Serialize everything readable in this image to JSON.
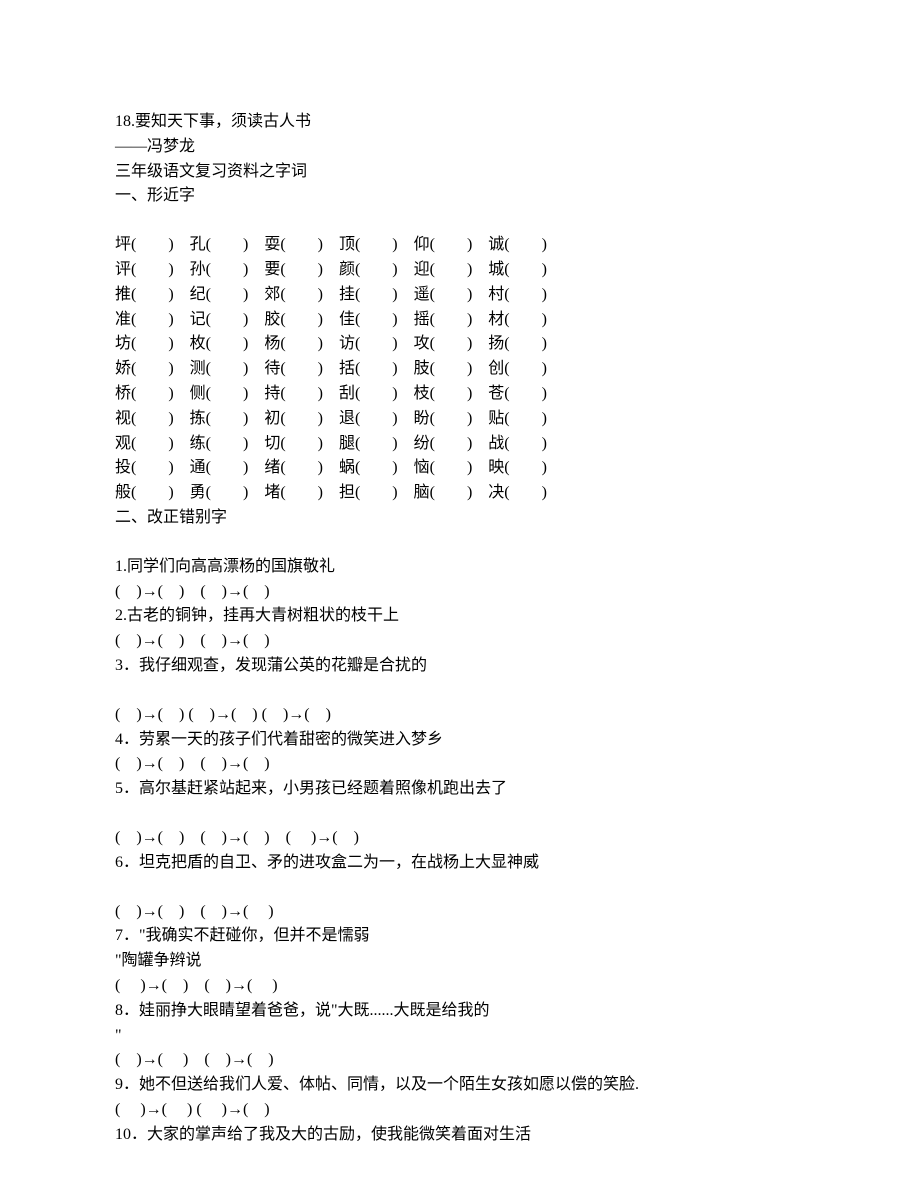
{
  "header": {
    "line1": "18.要知天下事，须读古人书",
    "line2": "——冯梦龙",
    "line3": "三年级语文复习资料之字词",
    "section1_title": "一、形近字"
  },
  "grid": [
    [
      "坪",
      "孔",
      "耍",
      "顶",
      "仰",
      "诚"
    ],
    [
      "评",
      "孙",
      "要",
      "颜",
      "迎",
      "城"
    ],
    [
      "推",
      "纪",
      "郊",
      "挂",
      "遥",
      "村"
    ],
    [
      "准",
      "记",
      "胶",
      "佳",
      "摇",
      "材"
    ],
    [
      "坊",
      "枚",
      "杨",
      "访",
      "攻",
      "扬"
    ],
    [
      "娇",
      "测",
      "待",
      "括",
      "肢",
      "创"
    ],
    [
      "桥",
      "侧",
      "持",
      "刮",
      "枝",
      "苍"
    ],
    [
      "视",
      "拣",
      "初",
      "退",
      "盼",
      "贴"
    ],
    [
      "观",
      "练",
      "切",
      "腿",
      "纷",
      "战"
    ],
    [
      "投",
      "通",
      "绪",
      "蜗",
      "恼",
      "映"
    ],
    [
      "般",
      "勇",
      "堵",
      "担",
      "脑",
      "决"
    ]
  ],
  "section2_title": "二、改正错别字",
  "q": {
    "q1": {
      "text": "1.同学们向高高漂杨的国旗敬礼",
      "ans": "(　)→(　)　(　)→(　)"
    },
    "q2": {
      "text": "2.古老的铜钟，挂再大青树粗状的枝干上",
      "ans": "(　)→(　)　(　)→(　)"
    },
    "q3": {
      "text": "3．我仔细观查，发现蒲公英的花瓣是合扰的",
      "ans": "(　)→(　) (　)→(　) (　)→(　)"
    },
    "q4": {
      "text": "4．劳累一天的孩子们代着甜密的微笑进入梦乡",
      "ans": "(　)→(　)　(　)→(　)"
    },
    "q5": {
      "text": "5．高尔基赶紧站起来，小男孩已经题着照像机跑出去了",
      "ans": "(　)→(　)　(　)→(　)　(　 )→(　)"
    },
    "q6": {
      "text": "6．坦克把盾的自卫、矛的进攻盒二为一，在战杨上大显神威",
      "ans": "(　)→(　)　(　)→(　 )"
    },
    "q7": {
      "text_a": "7．\"我确实不赶碰你，但并不是懦弱",
      "text_b": "\"陶罐争辫说",
      "ans": "(　 )→(　)　(　)→(　 )"
    },
    "q8": {
      "text_a": "8．娃丽挣大眼睛望着爸爸，说\"大既......大既是给我的",
      "text_b": "\"",
      "ans": "(　)→(　 )　(　)→(　)"
    },
    "q9": {
      "text": "9．她不但送给我们人爱、体帖、同情，以及一个陌生女孩如愿以偿的笑脸.",
      "ans": "(　 )→(　 ) (　 )→(　)"
    },
    "q10": {
      "text": "10．大家的掌声给了我及大的古励，使我能微笑着面对生活"
    }
  }
}
